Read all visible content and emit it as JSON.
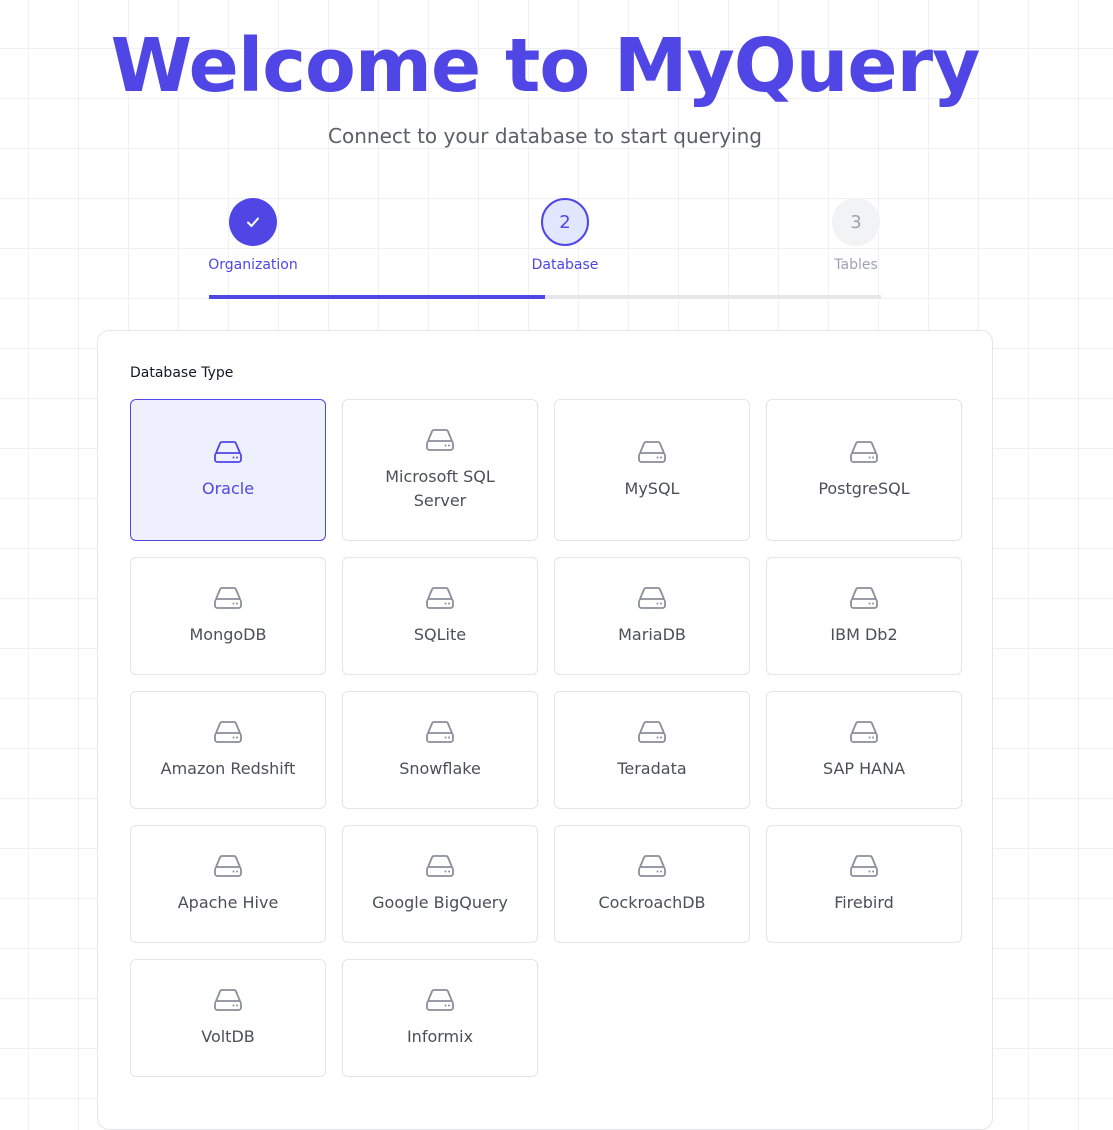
{
  "hero": {
    "title": "Welcome to MyQuery",
    "subtitle": "Connect to your database to start querying"
  },
  "stepper": {
    "steps": [
      {
        "number": "1",
        "label": "Organization",
        "status": "complete"
      },
      {
        "number": "2",
        "label": "Database",
        "status": "active"
      },
      {
        "number": "3",
        "label": "Tables",
        "status": "pending"
      }
    ],
    "progress_fraction": 0.5
  },
  "database_section": {
    "label": "Database Type",
    "selected": "Oracle",
    "icon": "database-drive-icon",
    "options": [
      "Oracle",
      "Microsoft SQL Server",
      "MySQL",
      "PostgreSQL",
      "MongoDB",
      "SQLite",
      "MariaDB",
      "IBM Db2",
      "Amazon Redshift",
      "Snowflake",
      "Teradata",
      "SAP HANA",
      "Apache Hive",
      "Google BigQuery",
      "CockroachDB",
      "Firebird",
      "VoltDB",
      "Informix"
    ]
  },
  "colors": {
    "accent": "#4f46e5",
    "accent_light": "#eef0fd",
    "pending": "#9ca3af",
    "text": "#3b3f48"
  }
}
